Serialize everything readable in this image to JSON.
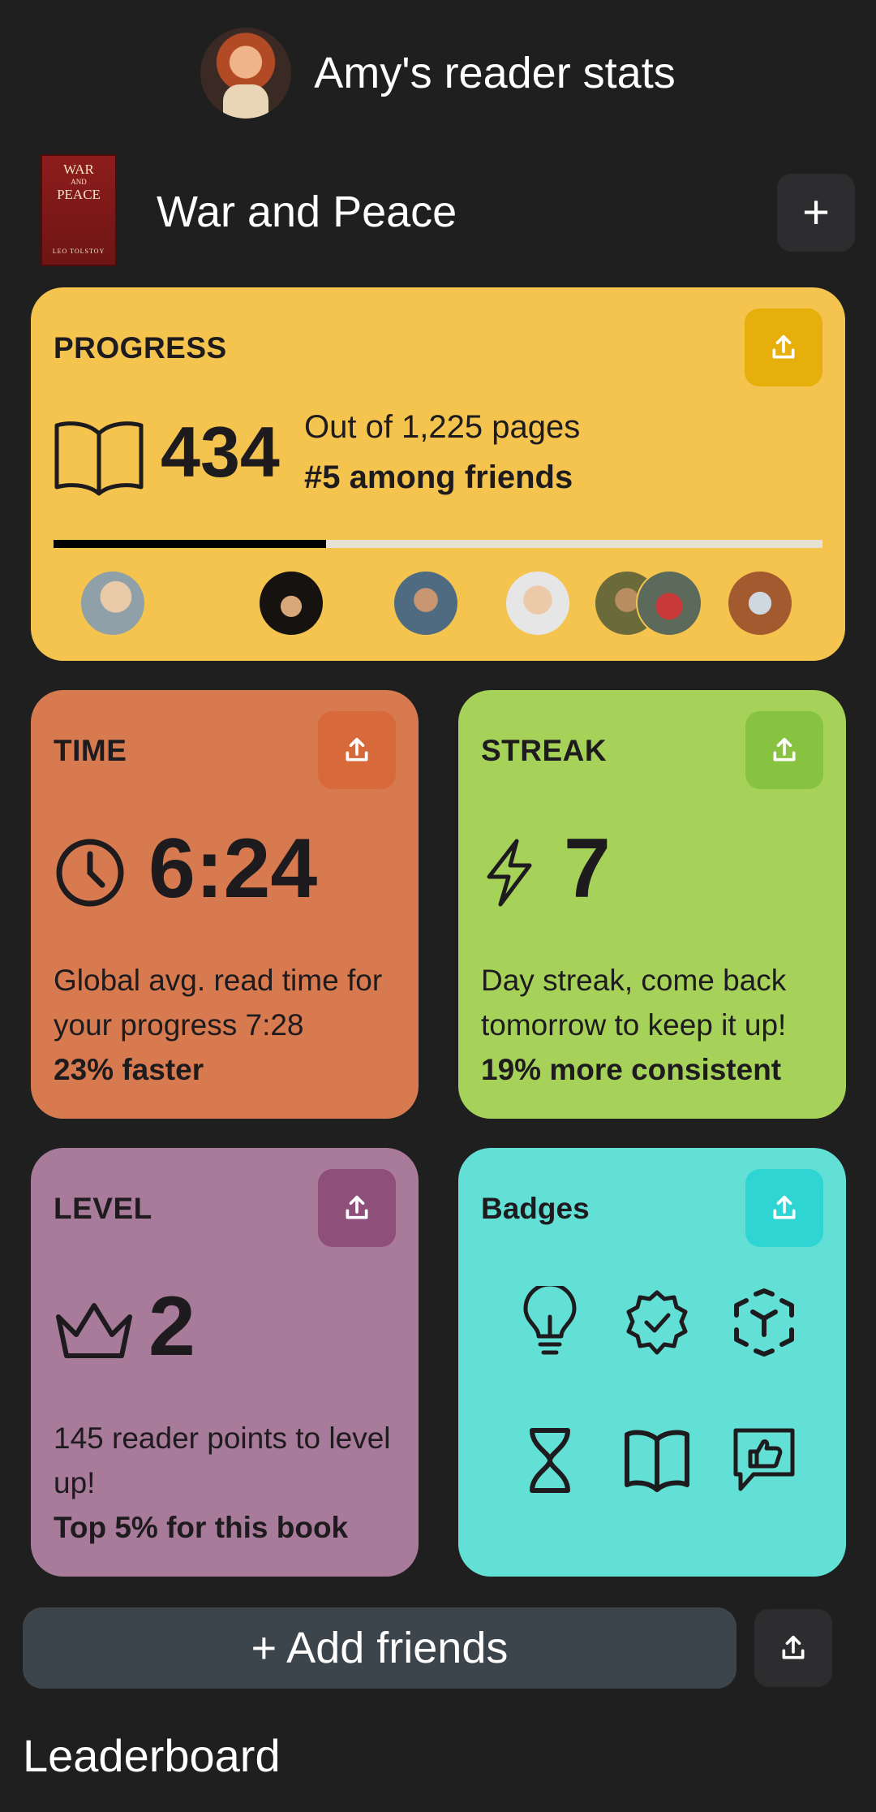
{
  "header": {
    "title": "Amy's reader stats",
    "avatar_icon": "avatar-icon"
  },
  "book": {
    "title": "War and Peace",
    "cover": {
      "line1": "WAR",
      "line2": "AND",
      "line3": "PEACE",
      "author": "LEO TOLSTOY"
    },
    "add_icon": "plus-icon",
    "add_label": "+"
  },
  "progress": {
    "title": "PROGRESS",
    "pages_read": "434",
    "total_text": "Out of 1,225 pages",
    "rank_text": "#5 among friends",
    "fraction": 0.354,
    "friends_count": 7
  },
  "time": {
    "title": "TIME",
    "value": "6:24",
    "desc": "Global avg. read time for your progress 7:28",
    "highlight": "23% faster"
  },
  "streak": {
    "title": "STREAK",
    "value": "7",
    "desc": "Day streak, come back tomorrow to keep it up!",
    "highlight": "19% more consistent"
  },
  "level": {
    "title": "LEVEL",
    "value": "2",
    "desc": "145 reader points to level up!",
    "highlight": "Top 5% for this book"
  },
  "badges": {
    "title": "Badges",
    "items": [
      "lightbulb-icon",
      "verified-badge-icon",
      "cube-icon",
      "hourglass-icon",
      "open-book-icon",
      "thumbs-up-message-icon"
    ]
  },
  "actions": {
    "add_friends": "+ Add friends"
  },
  "leaderboard": {
    "title": "Leaderboard"
  },
  "colors": {
    "background": "#1f1f20",
    "progress": "#f4c44e",
    "time": "#d77a4f",
    "streak": "#a6d25a",
    "level": "#a97b9a",
    "badges": "#63e0d6"
  }
}
